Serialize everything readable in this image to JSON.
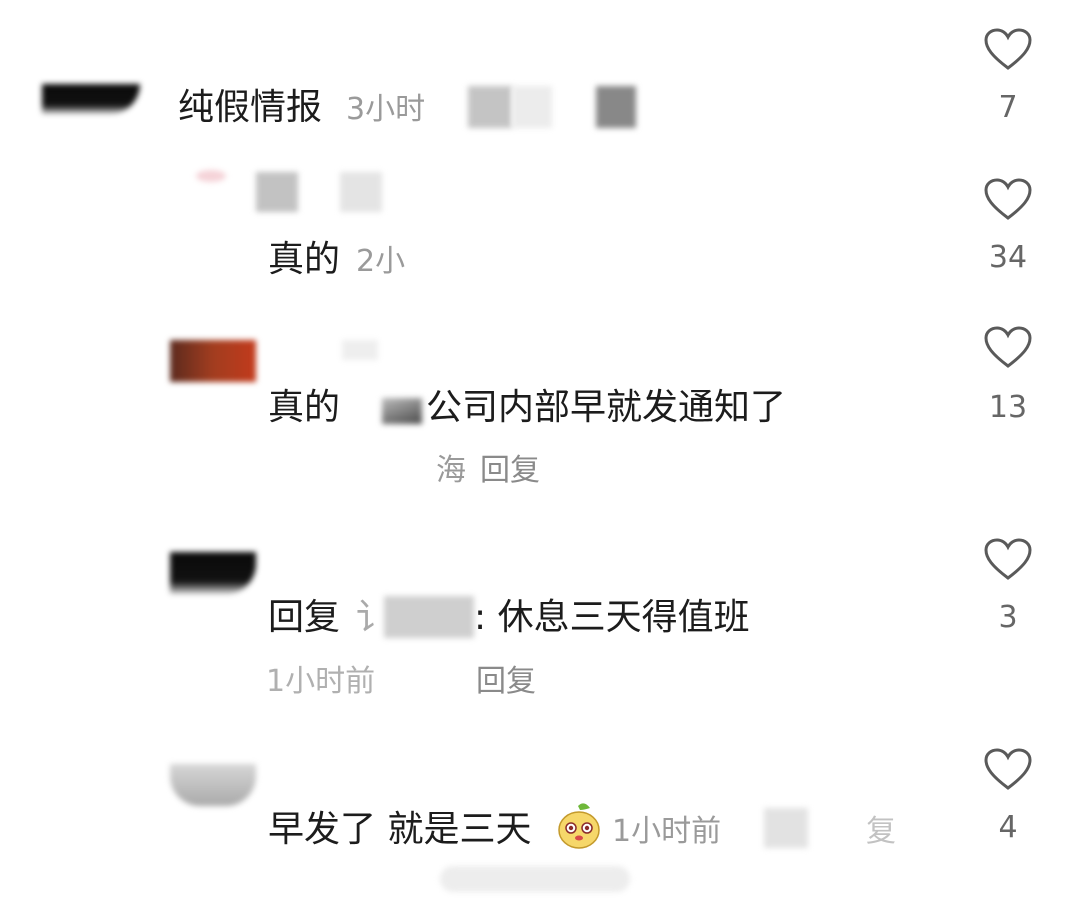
{
  "comments": [
    {
      "id": "c1",
      "text": "纯假情报",
      "meta": "3小时",
      "likes": "7"
    },
    {
      "id": "c2",
      "text": "真的",
      "meta": "2小",
      "likes": "34"
    },
    {
      "id": "c3",
      "text_a": "真的",
      "text_b": "公司内部早就发通知了",
      "location": "海",
      "reply_label": "回复",
      "likes": "13"
    },
    {
      "id": "c4",
      "prefix": "回复",
      "target": "讠",
      "body": ": 休息三天得值班",
      "meta": "1小时前",
      "reply_label": "回复",
      "likes": "3"
    },
    {
      "id": "c5",
      "text": "早发了 就是三天",
      "meta": "1小时前",
      "reply_tail": "复",
      "likes": "4"
    }
  ],
  "colors": {
    "heart_stroke": "#5a5a5a",
    "text": "#1c1c1c",
    "meta": "#9a9a9a"
  },
  "icons": {
    "like": "heart-outline-icon",
    "emoji": "peach-face-emoji"
  }
}
